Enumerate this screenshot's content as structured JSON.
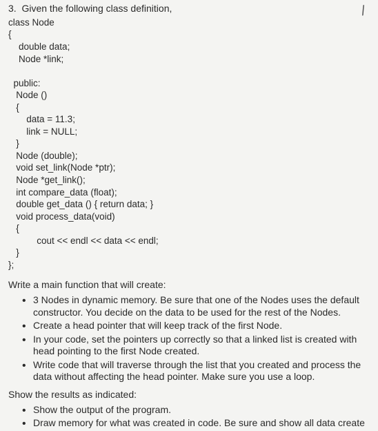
{
  "question": {
    "number": "3.",
    "prompt": "Given the following class definition,"
  },
  "code": "class Node\n{\n    double data;\n    Node *link;\n\n  public:\n   Node ()\n   {\n       data = 11.3;\n       link = NULL;\n   }\n   Node (double);\n   void set_link(Node *ptr);\n   Node *get_link();\n   int compare_data (float);\n   double get_data () { return data; }\n   void process_data(void)\n   {\n           cout << endl << data << endl;\n   }\n};",
  "section1": {
    "intro": "Write a main function that will create:",
    "bullets": [
      "3 Nodes in dynamic memory.  Be sure that one of the Nodes uses the default constructor.  You decide on the data to be used for the rest of the Nodes.",
      "Create a head pointer that will keep track of the first Node.",
      "In your code, set the pointers up correctly so that a linked list is created with head pointing to the first Node created.",
      "Write code that will traverse through the list that you created and process the data without affecting the head pointer.  Make sure you use a loop."
    ]
  },
  "section2": {
    "intro": "Show the results as indicated:",
    "bullets": [
      "Show the output of the program.",
      "Draw memory for what was created in code.  Be sure and show all data create"
    ]
  },
  "corner_glyph": "/"
}
